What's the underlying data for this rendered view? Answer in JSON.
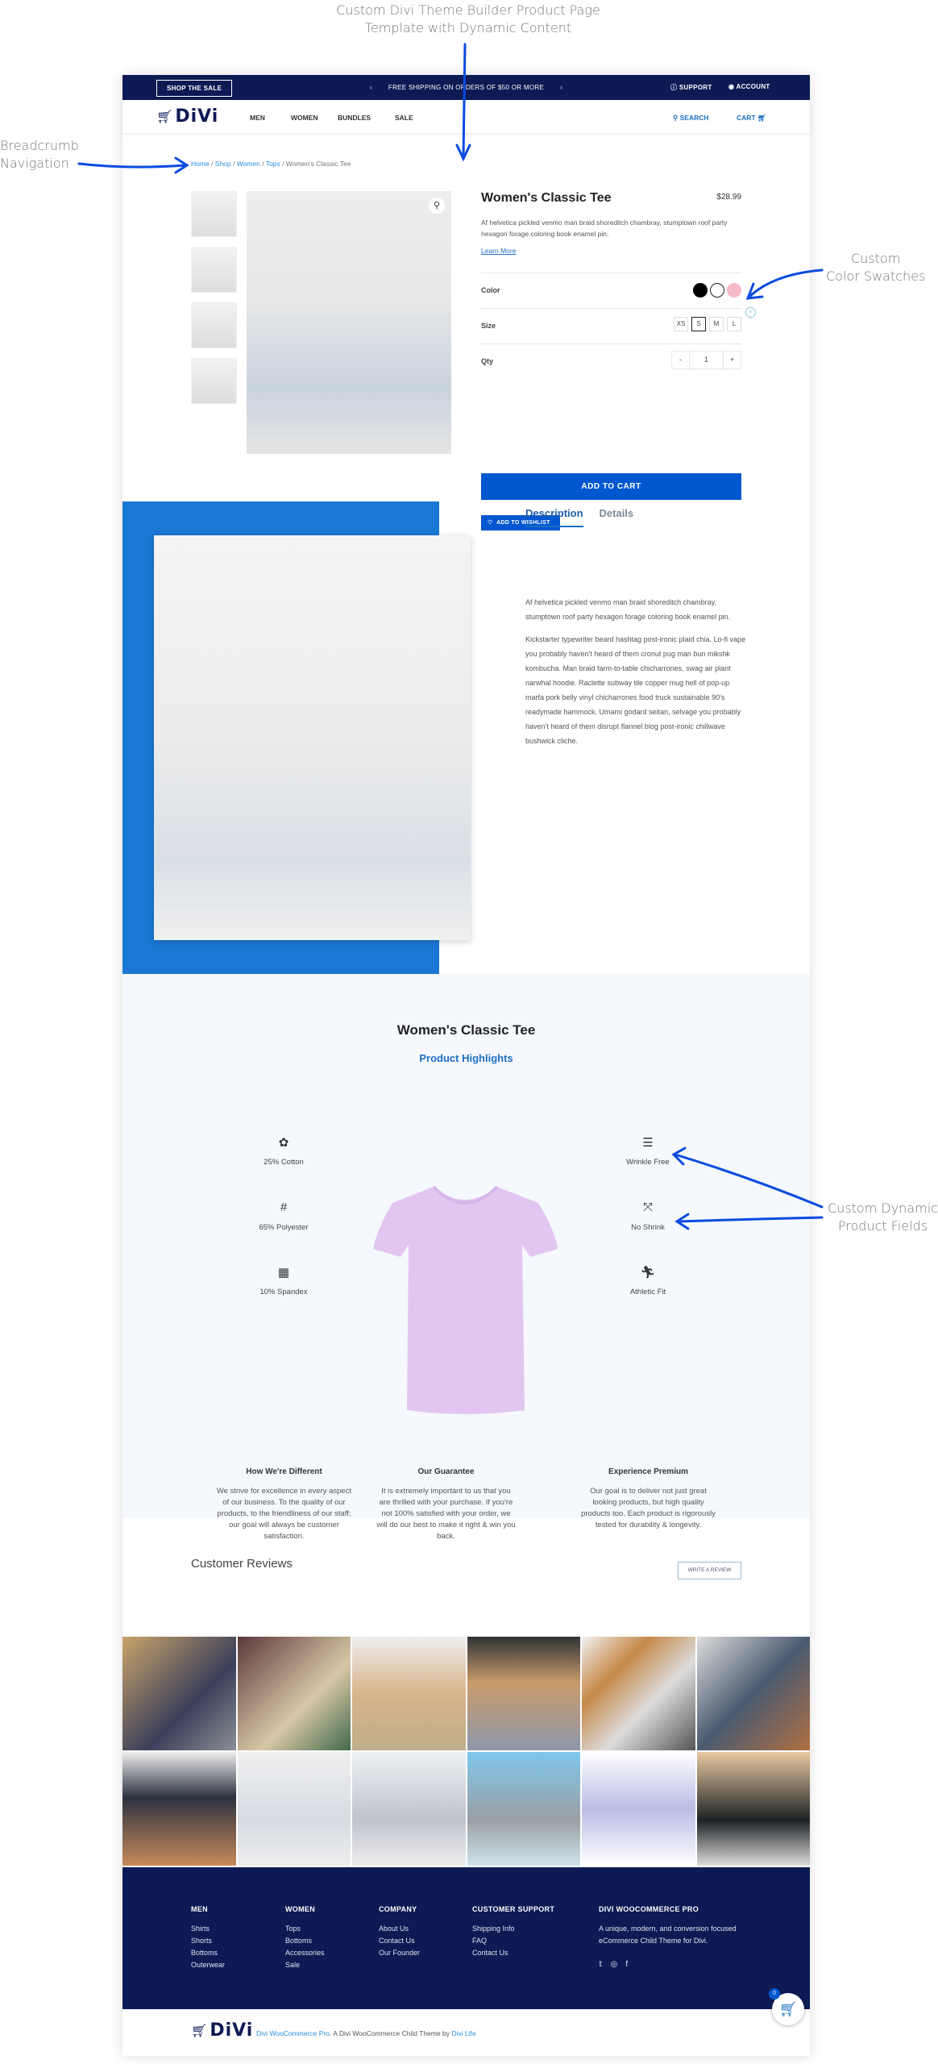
{
  "annotations": {
    "title_line1": "Custom Divi Theme Builder Product Page",
    "title_line2": "Template with Dynamic Content",
    "breadcrumb_line1": "Breadcrumb",
    "breadcrumb_line2": "Navigation",
    "swatch_line1": "Custom",
    "swatch_line2": "Color Swatches",
    "fields_line1": "Custom Dynamic",
    "fields_line2": "Product Fields",
    "arrow_color": "#0a4be0"
  },
  "topbar": {
    "sale_button": "SHOP THE SALE",
    "shipping": "FREE SHIPPING ON ORDERS OF $50 OR MORE",
    "support": "SUPPORT",
    "account": "ACCOUNT",
    "prev": "‹",
    "next": "›"
  },
  "nav": {
    "logo": "DiVi",
    "items": [
      "MEN",
      "WOMEN",
      "BUNDLES",
      "SALE"
    ],
    "search": "SEARCH",
    "cart": "CART"
  },
  "breadcrumb": {
    "items": [
      "Home",
      "Shop",
      "Women",
      "Tops"
    ],
    "current": "Women's Classic Tee",
    "sep": " / "
  },
  "product": {
    "title": "Women's Classic Tee",
    "price": "$28.99",
    "short_description": "Af helvetica pickled venmo man braid shoreditch chambray, stumptown roof party hexagon forage coloring book enamel pin.",
    "learn_more": "Learn More",
    "color_label": "Color",
    "colors": [
      "#000000",
      "#ffffff",
      "#f6b9c8"
    ],
    "size_label": "Size",
    "sizes": [
      "XS",
      "S",
      "M",
      "L"
    ],
    "selected_size": "S",
    "clear": "×",
    "qty_label": "Qty",
    "qty_minus": "-",
    "qty": "1",
    "qty_plus": "+",
    "add_to_cart": "ADD TO CART",
    "add_to_wishlist": "ADD TO WISHLIST"
  },
  "tabs": {
    "items": [
      "Description",
      "Details"
    ],
    "active": "Description",
    "paragraphs": [
      "Af helvetica pickled venmo man braid shoreditch chambray, stumptown roof party hexagon forage coloring book enamel pin.",
      "Kickstarter typewriter beard hashtag post-ironic plaid chia. Lo-fi vape you probably haven't heard of them cronut pug man bun mikshk kombucha. Man braid farm-to-table chicharrones, swag air plant narwhal hoodie. Raclette subway tile copper mug hell of pop-up marfa pork belly vinyl chicharrones food truck sustainable 90's readymade hammock. Umami godard seitan, selvage you probably haven't heard of them disrupt flannel blog post-ironic chillwave bushwick cliche."
    ]
  },
  "highlights": {
    "title": "Women's Classic Tee",
    "subtitle": "Product Highlights",
    "left": [
      {
        "icon": "cotton-icon",
        "label": "25% Cotton"
      },
      {
        "icon": "polyester-weave-icon",
        "label": "65% Polyester"
      },
      {
        "icon": "spandex-fabric-icon",
        "label": "10% Spandex"
      }
    ],
    "right": [
      {
        "icon": "wrinkle-free-icon",
        "label": "Wrinkle Free"
      },
      {
        "icon": "no-shrink-icon",
        "label": "No Shrink"
      },
      {
        "icon": "athletic-fit-icon",
        "label": "Athletic Fit"
      }
    ],
    "tee_color": "#e2c6f0",
    "columns": [
      {
        "title": "How We're Different",
        "text": "We strive for excellence in every aspect of our business. To the quality of our products, to the friendliness of our staff; our goal will always be customer satisfaction."
      },
      {
        "title": "Our Guarantee",
        "text": "It is extremely important to us that you are thrilled with your purchase. If you're not 100% satisfied with your order, we will do our best to make it right & win you back."
      },
      {
        "title": "Experience Premium",
        "text": "Our goal is to deliver not just great looking products, but high quality products too. Each product is rigorously tested for durability & longevity."
      }
    ]
  },
  "reviews": {
    "title": "Customer Reviews",
    "write_button": "WRITE A REVIEW"
  },
  "footer": {
    "columns": [
      {
        "title": "MEN",
        "links": [
          "Shirts",
          "Shorts",
          "Bottoms",
          "Outerwear"
        ]
      },
      {
        "title": "WOMEN",
        "links": [
          "Tops",
          "Bottoms",
          "Accessories",
          "Sale"
        ]
      },
      {
        "title": "COMPANY",
        "links": [
          "About Us",
          "Contact Us",
          "Our Founder"
        ]
      },
      {
        "title": "CUSTOMER SUPPORT",
        "links": [
          "Shipping Info",
          "FAQ",
          "Contact Us"
        ]
      }
    ],
    "about_title": "DIVI WOOCOMMERCE PRO",
    "about_text": "A unique, modern, and conversion focused eCommerce Child Theme for Divi.",
    "social": [
      "twitter-icon",
      "instagram-icon",
      "facebook-icon"
    ],
    "credit_link1": "Divi WooCommerce Pro",
    "credit_mid": ". A Divi WooCommerce Child Theme by ",
    "credit_link2": "Divi Life",
    "cart_count": "0"
  },
  "colors": {
    "navy": "#0d1a54",
    "accent": "#0057d0",
    "link": "#1d6fc4",
    "hero_blue": "#1b77d4",
    "highlights_bg": "#f5f8fd"
  }
}
